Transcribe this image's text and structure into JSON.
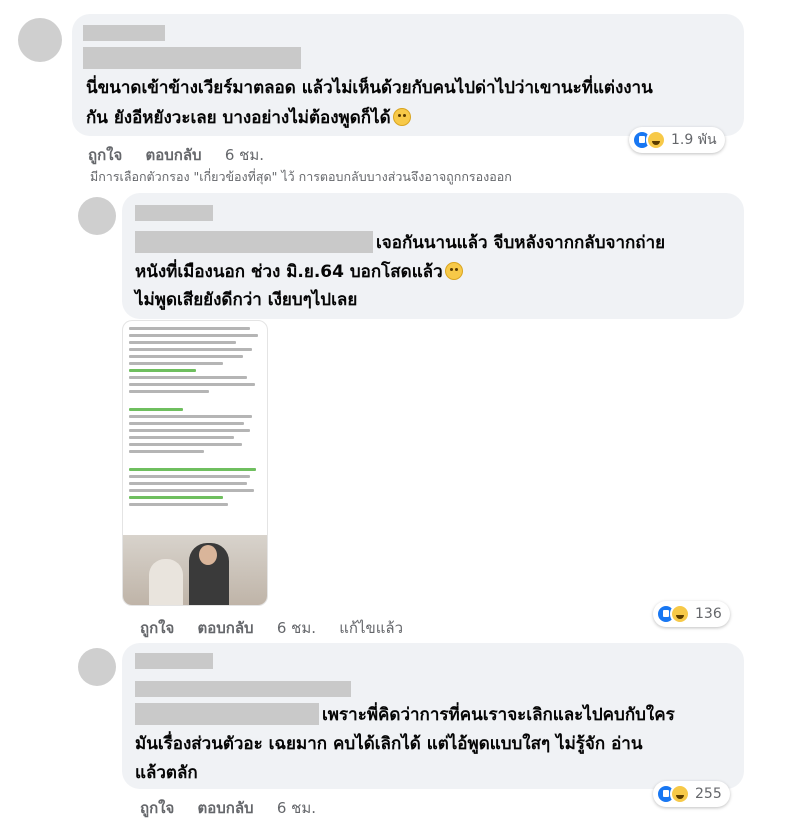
{
  "comments": [
    {
      "text_lines": [
        "นี่ขนาดเข้าข้างเวียร์มาตลอด แล้วไม่เห็นด้วยกับคนไปด่าไปว่าเขานะที่แต่งงาน",
        "กัน ยังอีหยังวะเลย บางอย่างไม่ต้องพูดก็ได้"
      ],
      "emoji": "rofl-emoji",
      "actions": {
        "like": "ถูกใจ",
        "reply": "ตอบกลับ",
        "time": "6 ชม."
      },
      "reaction_count": "1.9 พัน"
    },
    {
      "text_lines": [
        "เจอกันนานแล้ว จีบหลังจากกลับจากถ่าย",
        "หนังที่เมืองนอก ช่วง มิ.ย.64 บอกโสดแล้ว",
        "ไม่พูดเสียยังดีกว่า เงียบๆไปเลย"
      ],
      "emoji": "rolling-eyes-emoji",
      "actions": {
        "like": "ถูกใจ",
        "reply": "ตอบกลับ",
        "time": "6 ชม.",
        "edited": "แก้ไขแล้ว"
      },
      "reaction_count": "136"
    },
    {
      "text_lines": [
        "เพราะพี่คิดว่าการที่คนเราจะเลิกและไปคบกับใคร",
        "มันเรื่องส่วนตัวอะ เฉยมาก คบได้เลิกได้ แต่ไอ้พูดแบบใสๆ ไม่รู้จัก อ่าน",
        "แล้วตลัก"
      ],
      "actions": {
        "like": "ถูกใจ",
        "reply": "ตอบกลับ",
        "time": "6 ชม."
      },
      "reaction_count": "255"
    }
  ],
  "filter_note": "มีการเลือกตัวกรอง \"เกี่ยวข้องที่สุด\" ไว้ การตอบกลับบางส่วนจึงอาจถูกกรองออก",
  "colors": {
    "bubble": "#f0f2f5",
    "like_blue": "#1877f2",
    "haha_yellow": "#f7c948",
    "meta_gray": "#65676b"
  }
}
